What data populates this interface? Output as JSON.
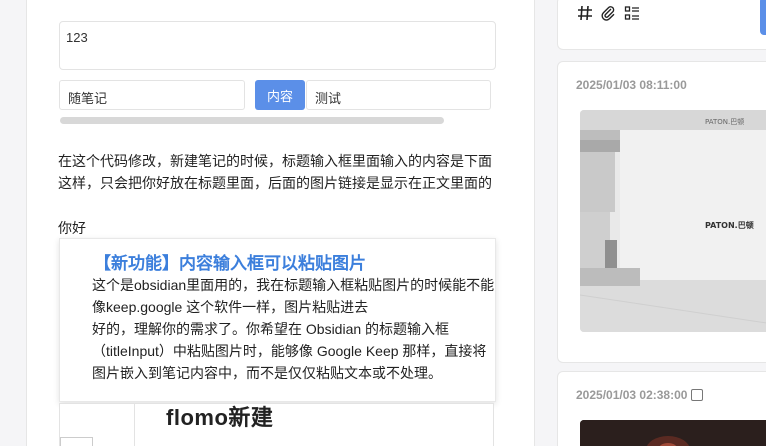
{
  "editor": {
    "title_value": "123",
    "field_left_value": "随笔记",
    "content_button": "内容",
    "field_right_value": "测试",
    "body_text": "在这个代码修改，新建笔记的时候，标题输入框里面输入的内容是下面这样，只会把你好放在标题里面，后面的图片链接是显示在正文里面的",
    "hello": "你好",
    "popup": {
      "title": "【新功能】内容输入框可以粘贴图片",
      "lines": [
        "这个是obsidian里面用的，我在标题输入框粘贴图片的时候能不能",
        "像keep.google 这个软件一样，图片粘贴进去",
        "好的，理解你的需求了。你希望在 Obsidian 的标题输入框",
        "（titleInput）中粘贴图片时，能够像 Google Keep 那样，直接将",
        "图片嵌入到笔记内容中，而不是仅仅粘贴文本或不处理。"
      ]
    },
    "preview_title": "flomo新建"
  },
  "sidebar": {
    "toolbar": {
      "icons": [
        "hash-icon",
        "paperclip-icon",
        "list-icon"
      ],
      "glyphs": [
        "#",
        "⌀",
        "☷"
      ]
    },
    "cards": [
      {
        "date": "2025/01/03 08:11:00",
        "photo_label": "PATON.巴顿",
        "photo_sign": "PATON.巴顿"
      },
      {
        "date": "2025/01/03 02:38:00"
      }
    ]
  },
  "colors": {
    "accent": "#5b8fe8",
    "link_title": "#3c7fdc"
  }
}
